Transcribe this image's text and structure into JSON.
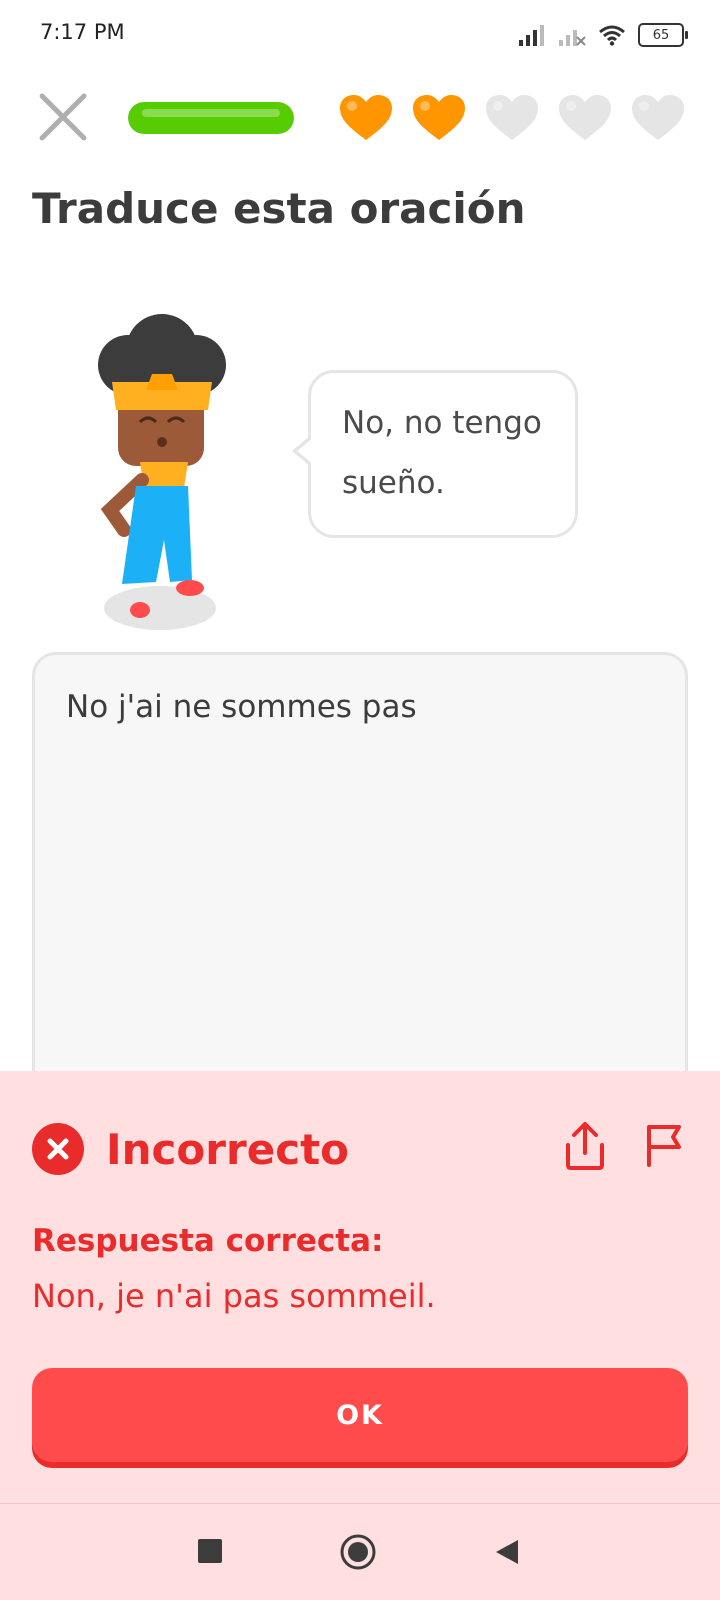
{
  "status_bar": {
    "time": "7:17 PM",
    "battery": "65"
  },
  "header": {
    "close_icon": "close-icon",
    "progress": 1.0,
    "hearts": [
      {
        "state": "filled",
        "color": "#ff9600"
      },
      {
        "state": "filled",
        "color": "#ff9600"
      },
      {
        "state": "empty",
        "color": "#e5e5e5"
      },
      {
        "state": "empty",
        "color": "#e5e5e5"
      },
      {
        "state": "empty",
        "color": "#e5e5e5"
      }
    ]
  },
  "exercise": {
    "title": "Traduce esta oración",
    "bubble_text_line1": "No, no tengo",
    "bubble_text_line2": "sueño."
  },
  "answer": {
    "text": "No j'ai ne sommes pas"
  },
  "feedback": {
    "title": "Incorrecto",
    "correct_label": "Respuesta correcta:",
    "correct_answer": "Non, je n'ai pas sommeil.",
    "ok_label": "OK",
    "icons": [
      "x-circle-icon",
      "share-icon",
      "flag-icon"
    ]
  },
  "nav_bar": {
    "icons": [
      "recents-square-icon",
      "home-circle-icon",
      "back-triangle-icon"
    ]
  },
  "colors": {
    "accent_green": "#58cc02",
    "heart_orange": "#ff9600",
    "error_red": "#ea2b2b",
    "button_red": "#ff4b4b",
    "feedback_bg": "#ffdfe0"
  }
}
